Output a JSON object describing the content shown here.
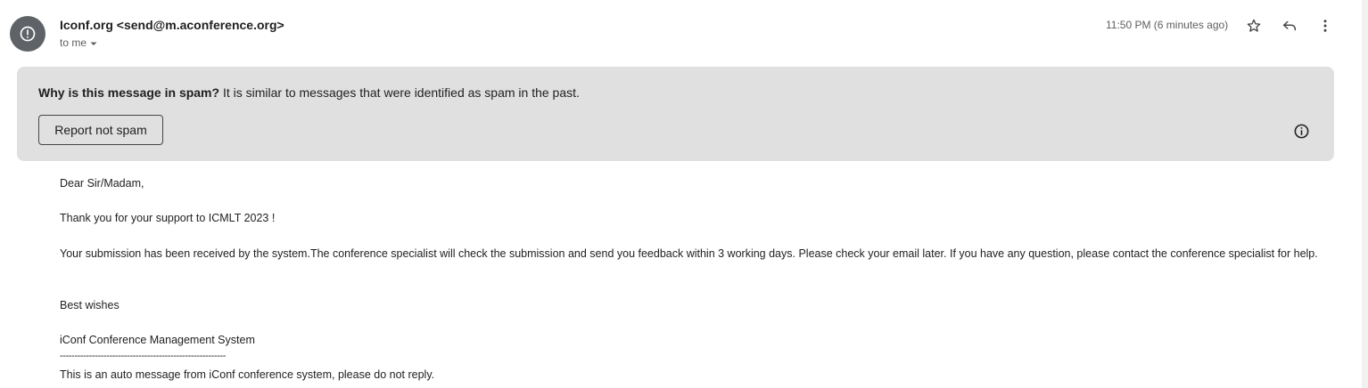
{
  "header": {
    "sender": "Iconf.org <send@m.aconference.org>",
    "recipient": "to me",
    "timestamp": "11:50 PM (6 minutes ago)"
  },
  "icons": {
    "avatar": "alert-circle-icon",
    "star": "star-icon",
    "reply": "reply-icon",
    "more": "more-vert-icon",
    "dropdown": "caret-down-icon",
    "info": "info-icon"
  },
  "spam_banner": {
    "question": "Why is this message in spam?",
    "explanation": "It is similar to messages that were identified as spam in the past.",
    "report_button": "Report not spam"
  },
  "message": {
    "greeting": "Dear Sir/Madam,",
    "thanks": "Thank you for your support to ICMLT 2023 !",
    "body": "Your submission has been received by the system.The conference specialist will check the submission and send you feedback within 3 working days. Please check your email later. If you have any question, please contact the conference specialist for help.",
    "closing": "Best wishes",
    "signature": "iConf Conference Management System",
    "divider": "---------------------------------------------------------",
    "footer": "This is an auto message from iConf conference system, please do not reply."
  },
  "colors": {
    "avatar_bg": "#5f6368",
    "banner_bg": "#e0e0e0",
    "text_primary": "#1f1f1f",
    "text_secondary": "#5e5e5e"
  }
}
